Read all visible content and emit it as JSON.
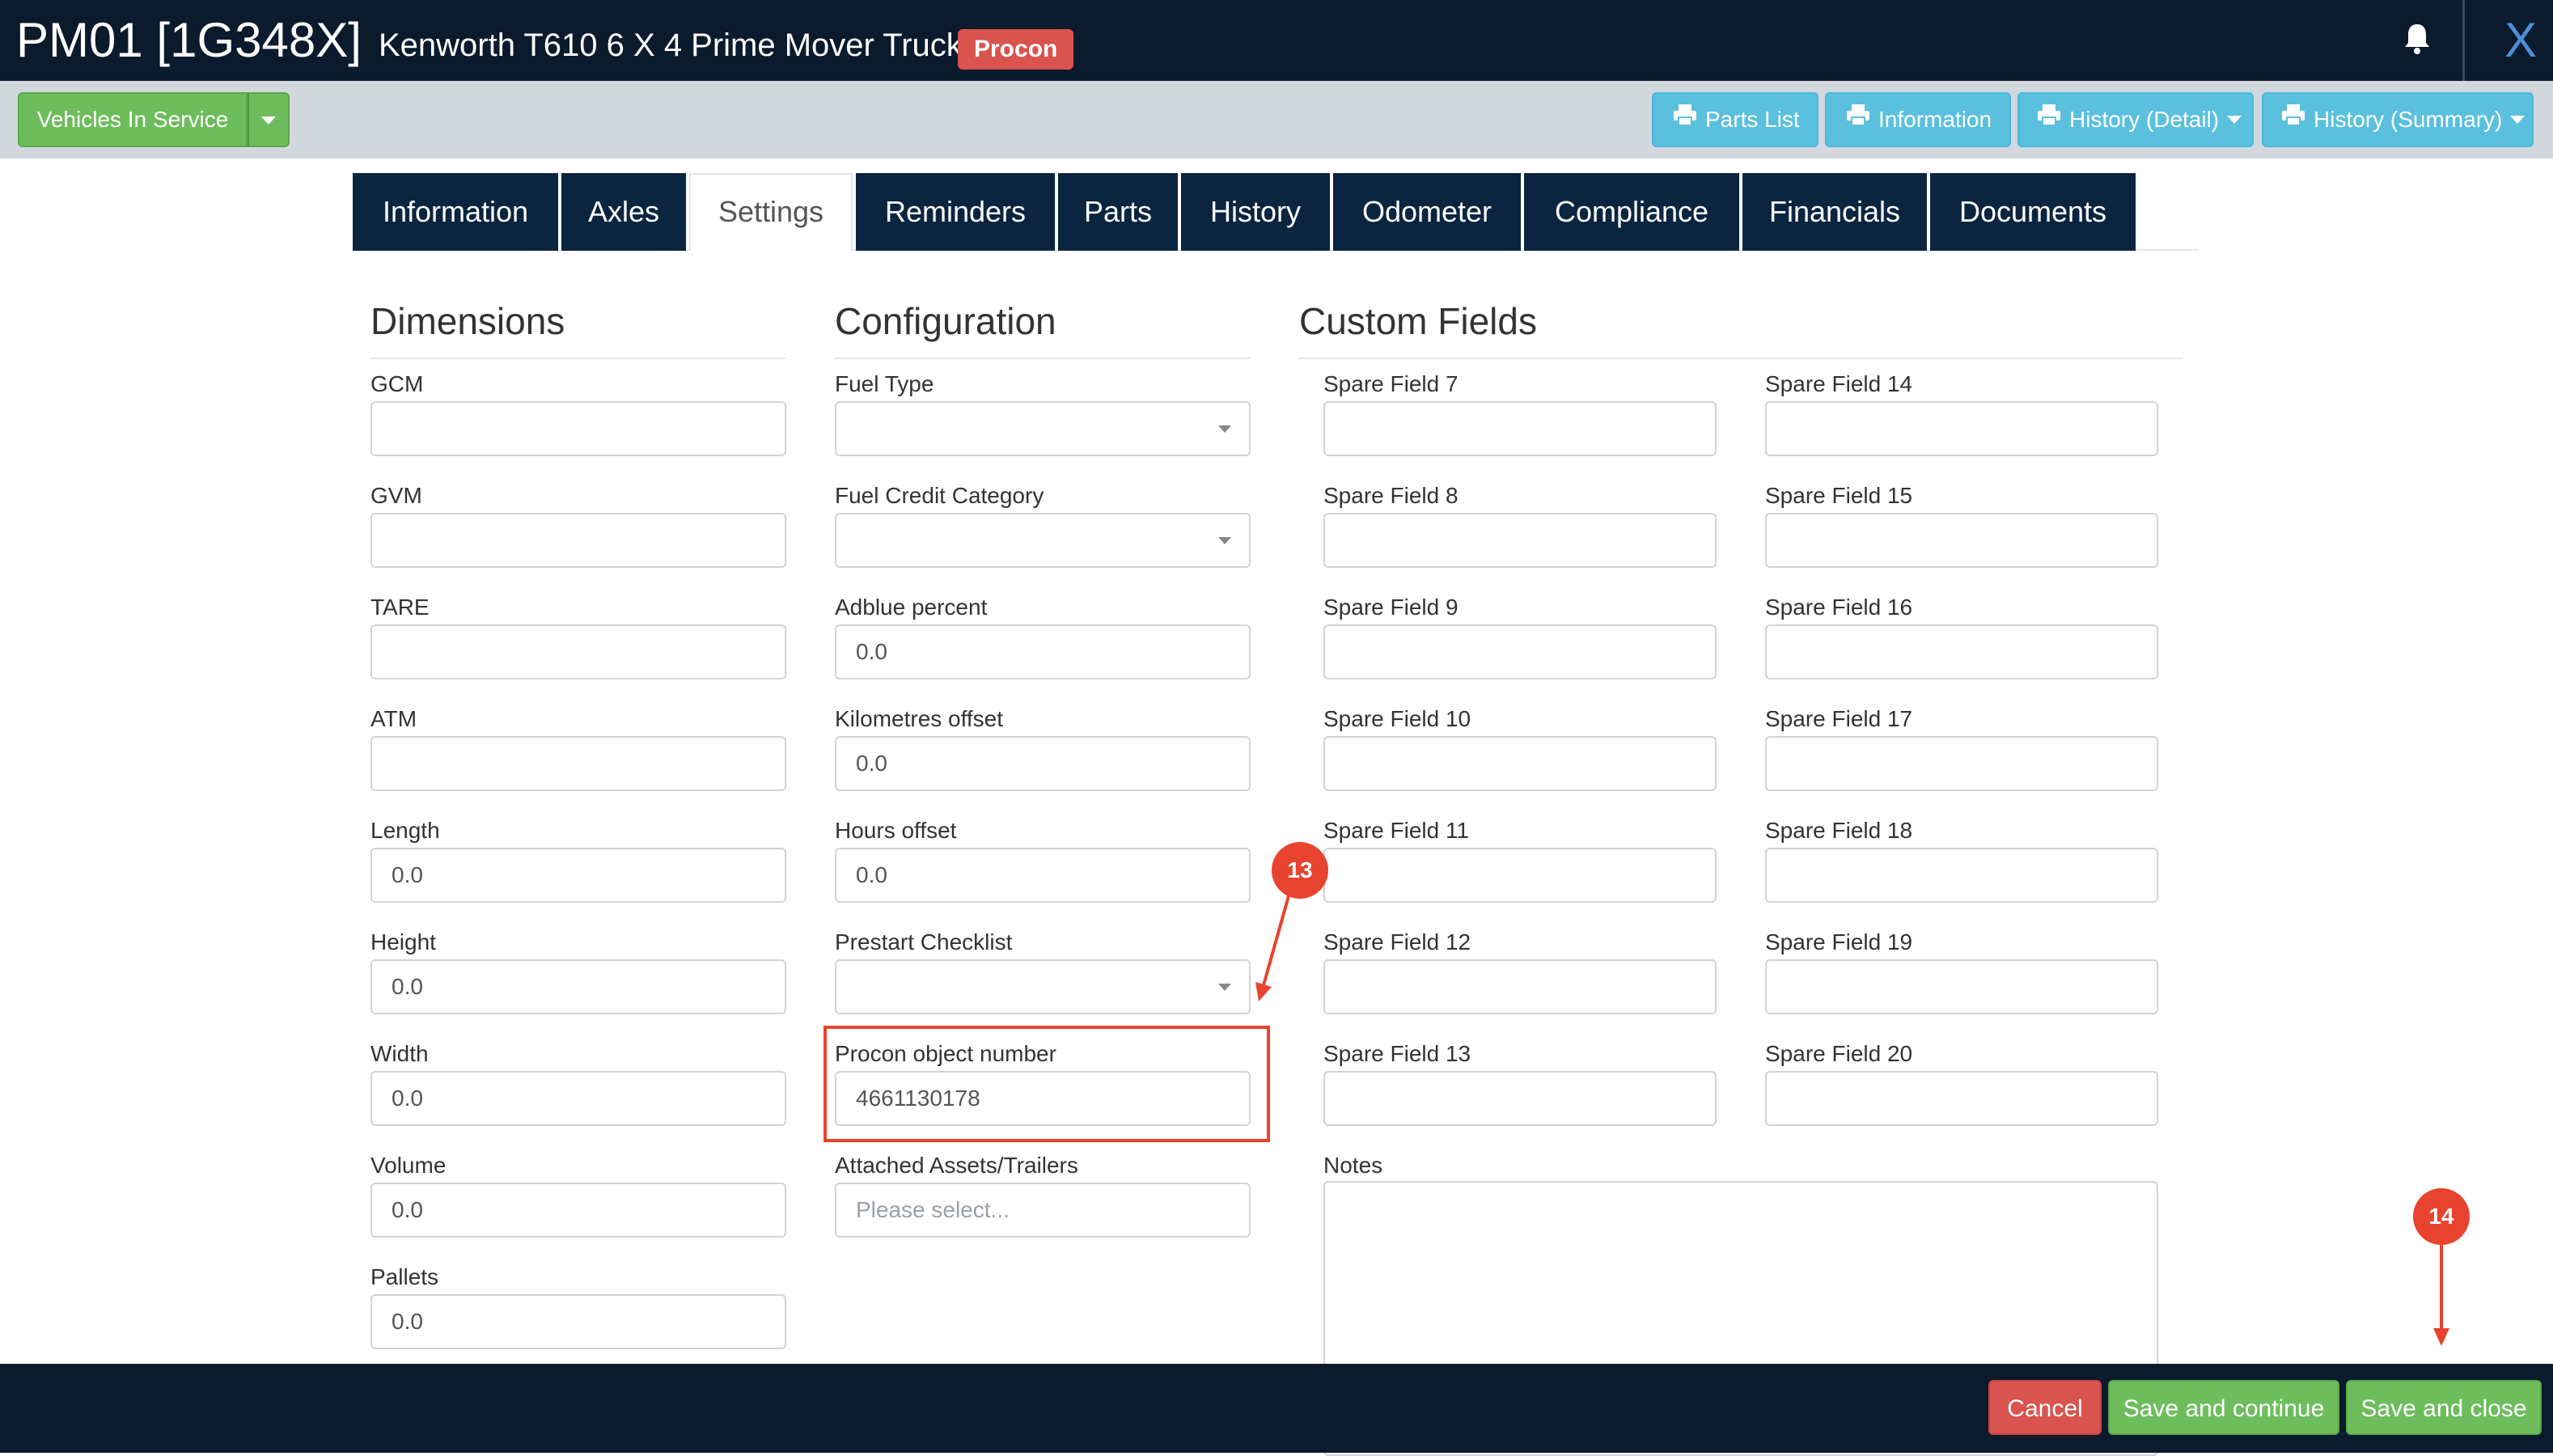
{
  "header": {
    "vehicle_code": "PM01 [1G348X]",
    "vehicle_name": "Kenworth T610 6 X 4 Prime Mover Truck",
    "badge": "Procon",
    "close_label": "X"
  },
  "toolbar": {
    "status_label": "Vehicles In Service",
    "buttons": [
      {
        "label": "Parts List"
      },
      {
        "label": "Information"
      },
      {
        "label": "History (Detail)"
      },
      {
        "label": "History (Summary)"
      }
    ]
  },
  "tabs": [
    "Information",
    "Axles",
    "Settings",
    "Reminders",
    "Parts",
    "History",
    "Odometer",
    "Compliance",
    "Financials",
    "Documents"
  ],
  "active_tab": "Settings",
  "dimensions": {
    "title": "Dimensions",
    "fields": [
      {
        "label": "GCM",
        "value": ""
      },
      {
        "label": "GVM",
        "value": ""
      },
      {
        "label": "TARE",
        "value": ""
      },
      {
        "label": "ATM",
        "value": ""
      },
      {
        "label": "Length",
        "value": "0.0"
      },
      {
        "label": "Height",
        "value": "0.0"
      },
      {
        "label": "Width",
        "value": "0.0"
      },
      {
        "label": "Volume",
        "value": "0.0"
      },
      {
        "label": "Pallets",
        "value": "0.0"
      }
    ]
  },
  "configuration": {
    "title": "Configuration",
    "fields": [
      {
        "label": "Fuel Type",
        "value": ""
      },
      {
        "label": "Fuel Credit Category",
        "value": ""
      },
      {
        "label": "Adblue percent",
        "value": "0.0"
      },
      {
        "label": "Kilometres offset",
        "value": "0.0"
      },
      {
        "label": "Hours offset",
        "value": "0.0"
      },
      {
        "label": "Prestart Checklist",
        "value": ""
      },
      {
        "label": "Procon object number",
        "value": "4661130178"
      },
      {
        "label": "Attached Assets/Trailers",
        "placeholder": "Please select..."
      }
    ]
  },
  "custom_fields": {
    "title": "Custom Fields",
    "left": [
      {
        "label": "Spare Field 7",
        "value": ""
      },
      {
        "label": "Spare Field 8",
        "value": ""
      },
      {
        "label": "Spare Field 9",
        "value": ""
      },
      {
        "label": "Spare Field 10",
        "value": ""
      },
      {
        "label": "Spare Field 11",
        "value": ""
      },
      {
        "label": "Spare Field 12",
        "value": ""
      },
      {
        "label": "Spare Field 13",
        "value": ""
      }
    ],
    "right": [
      {
        "label": "Spare Field 14",
        "value": ""
      },
      {
        "label": "Spare Field 15",
        "value": ""
      },
      {
        "label": "Spare Field 16",
        "value": ""
      },
      {
        "label": "Spare Field 17",
        "value": ""
      },
      {
        "label": "Spare Field 18",
        "value": ""
      },
      {
        "label": "Spare Field 19",
        "value": ""
      },
      {
        "label": "Spare Field 20",
        "value": ""
      }
    ],
    "notes_label": "Notes",
    "notes_value": ""
  },
  "annotations": {
    "marker_13": "13",
    "marker_14": "14"
  },
  "footer": {
    "cancel": "Cancel",
    "save_continue": "Save and continue",
    "save_close": "Save and close"
  },
  "colors": {
    "header_bg": "#0b1a2c",
    "tab_bg": "#0b2540",
    "status_green": "#6ebd5d",
    "action_blue": "#5bc0de",
    "cancel_red": "#d9534f",
    "badge_red": "#d9534f",
    "annotation_red": "#e8432e",
    "close_blue": "#4a90d9"
  }
}
